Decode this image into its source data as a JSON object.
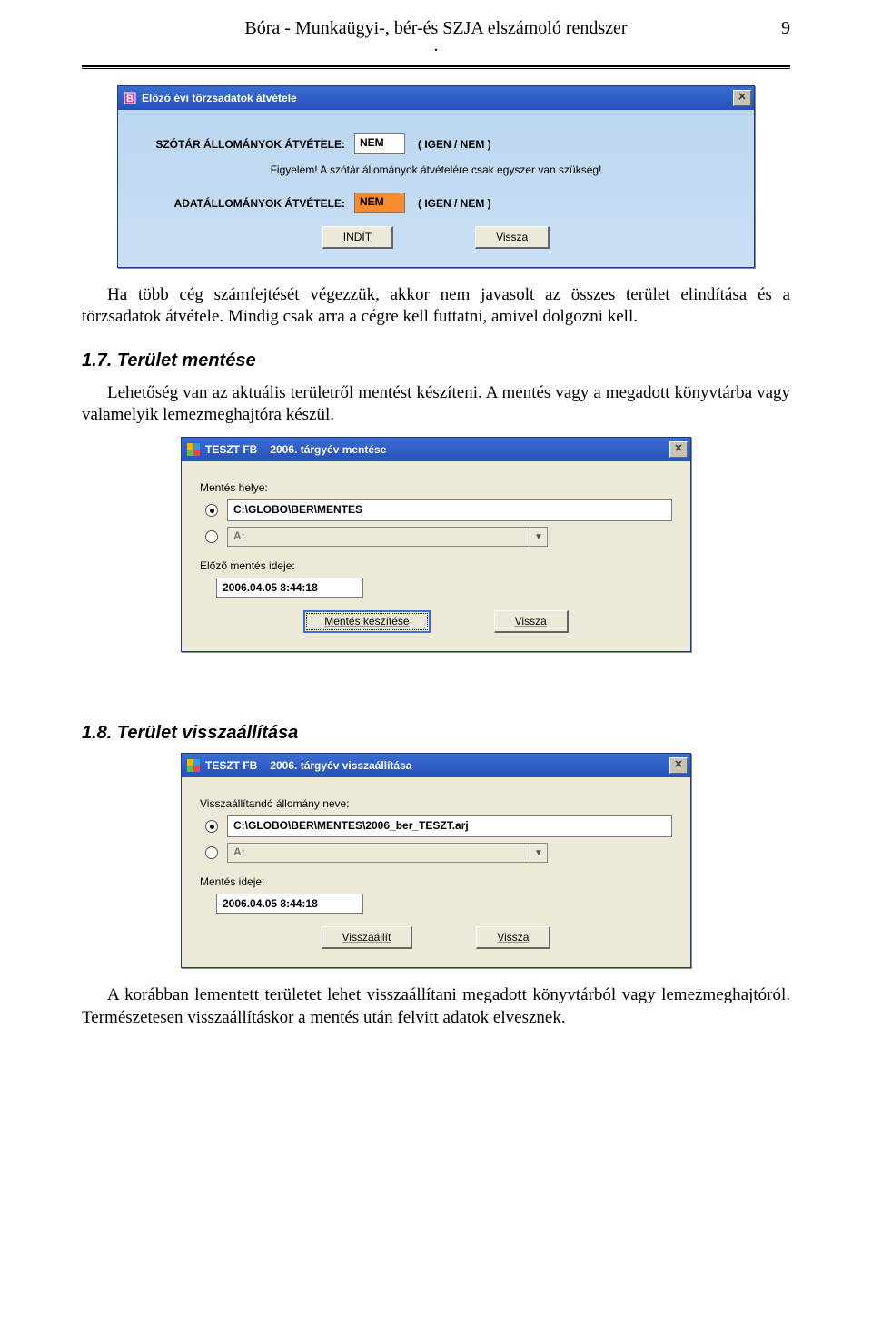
{
  "header": {
    "title": "Bóra - Munkaügyi-, bér-és SZJA elszámoló rendszer",
    "page_number": "9",
    "dot": "."
  },
  "dialog1": {
    "title": "Előző évi törzsadatok átvétele",
    "label1": "SZÓTÁR ÁLLOMÁNYOK ÁTVÉTELE:",
    "value1": "NEM",
    "hint1": "( IGEN / NEM )",
    "note": "Figyelem! A szótár állományok átvételére csak egyszer van szükség!",
    "label2": "ADATÁLLOMÁNYOK ÁTVÉTELE:",
    "value2": "NEM",
    "hint2": "( IGEN / NEM )",
    "btn_go": "INDÍT",
    "btn_back": "Vissza"
  },
  "para1": "Ha több cég számfejtését végezzük, akkor nem javasolt az összes terület elindítása és a törzsadatok átvétele. Mindig csak arra a cégre kell futtatni, amivel dolgozni kell.",
  "section17": {
    "title": "1.7.   Terület mentése",
    "text": "Lehetőség van az aktuális területről mentést készíteni. A mentés vagy a megadott könyvtárba vagy valamelyik lemezmeghajtóra készül."
  },
  "dialog2": {
    "title_left": "TESZT FB",
    "title_right": "2006. tárgyév mentése",
    "label_loc": "Mentés helye:",
    "opt1_value": "C:\\GLOBO\\BER\\MENTES",
    "opt2_value": "A:",
    "label_prev": "Előző mentés ideje:",
    "prev_value": "2006.04.05 8:44:18",
    "btn_make": "Mentés készítése",
    "btn_back": "Vissza"
  },
  "section18": {
    "title": "1.8.   Terület visszaállítása"
  },
  "dialog3": {
    "title_left": "TESZT FB",
    "title_right": "2006. tárgyév visszaállítása",
    "label_file": "Visszaállítandó állomány neve:",
    "opt1_value": "C:\\GLOBO\\BER\\MENTES\\2006_ber_TESZT.arj",
    "opt2_value": "A:",
    "label_time": "Mentés ideje:",
    "time_value": "2006.04.05 8:44:18",
    "btn_restore": "Visszaállít",
    "btn_back": "Vissza"
  },
  "para_last": "A korábban lementett területet lehet visszaállítani megadott könyvtárból vagy lemezmeghajtóról. Természetesen visszaállításkor a mentés után felvitt adatok elvesznek."
}
